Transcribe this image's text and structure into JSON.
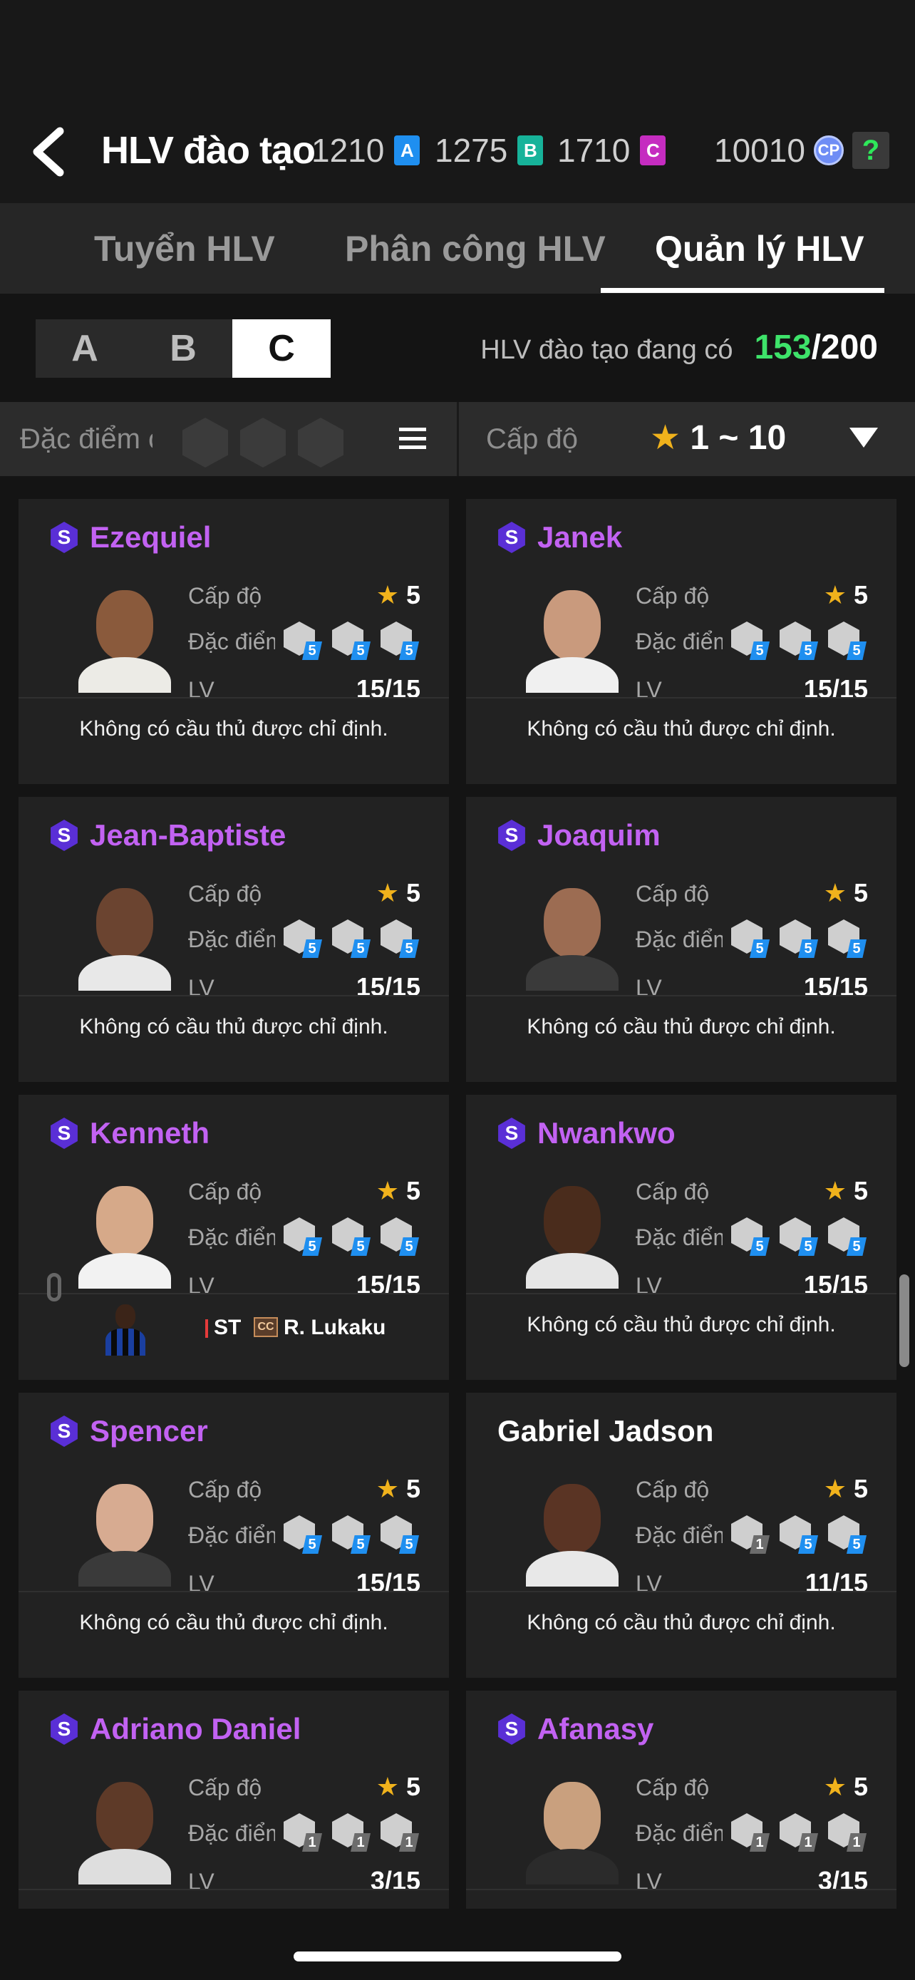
{
  "header": {
    "title": "HLV đào tạo",
    "currencies": [
      {
        "amount": "1210",
        "badge": "A",
        "color": "#1f8ff0"
      },
      {
        "amount": "1275",
        "badge": "B",
        "color": "#17b39a"
      },
      {
        "amount": "1710",
        "badge": "C",
        "color": "#c52cc0"
      }
    ],
    "cp_amount": "10010",
    "cp_badge": "CP",
    "help": "?"
  },
  "tabs": [
    "Tuyển HLV",
    "Phân công HLV",
    "Quản lý HLV"
  ],
  "active_tab": 2,
  "segments": [
    "A",
    "B",
    "C"
  ],
  "active_segment": 2,
  "count": {
    "label": "HLV đào tạo đang có",
    "current": "153",
    "max": "/200"
  },
  "filter": {
    "traits_label": "Đặc điểm c",
    "level_label": "Cấp độ",
    "level_range": "1 ~ 10"
  },
  "labels": {
    "level": "Cấp độ",
    "traits": "Đặc điểm",
    "traits_cut": "Đặc điểm",
    "lv": "LV",
    "none": "Không có cầu thủ được chỉ định."
  },
  "coaches": [
    {
      "name": "Ezequiel",
      "special": true,
      "badge": "S",
      "level": "5",
      "lv": "15/15",
      "traits": [
        "5",
        "5",
        "5"
      ],
      "assigned": false,
      "skin": "#8a5a3c",
      "shirt": "#ecebe6"
    },
    {
      "name": "Janek",
      "special": true,
      "badge": "S",
      "level": "5",
      "lv": "15/15",
      "traits": [
        "5",
        "5",
        "5"
      ],
      "assigned": false,
      "skin": "#c99a7d",
      "shirt": "#f0f0f0"
    },
    {
      "name": "Jean-Baptiste",
      "special": true,
      "badge": "S",
      "level": "5",
      "lv": "15/15",
      "traits": [
        "5",
        "5",
        "5"
      ],
      "assigned": false,
      "skin": "#6b4430",
      "shirt": "#e8e8e8"
    },
    {
      "name": "Joaquim",
      "special": true,
      "badge": "S",
      "level": "5",
      "lv": "15/15",
      "traits": [
        "5",
        "5",
        "5"
      ],
      "assigned": false,
      "skin": "#9c6c52",
      "shirt": "#3a3a3a"
    },
    {
      "name": "Kenneth",
      "special": true,
      "badge": "S",
      "level": "5",
      "lv": "15/15",
      "traits": [
        "5",
        "5",
        "5"
      ],
      "assigned": true,
      "player_pos": "ST",
      "player_cc": "CC",
      "player_name": "R. Lukaku",
      "skin": "#d6a989",
      "shirt": "#f2f2f2"
    },
    {
      "name": "Nwankwo",
      "special": true,
      "badge": "S",
      "level": "5",
      "lv": "15/15",
      "traits": [
        "5",
        "5",
        "5"
      ],
      "assigned": false,
      "skin": "#4a2c1c",
      "shirt": "#e6e6e6"
    },
    {
      "name": "Spencer",
      "special": true,
      "badge": "S",
      "level": "5",
      "lv": "15/15",
      "traits": [
        "5",
        "5",
        "5"
      ],
      "assigned": false,
      "skin": "#d7ab91",
      "shirt": "#3a3a3a"
    },
    {
      "name": "Gabriel Jadson",
      "special": false,
      "badge": "",
      "level": "5",
      "lv": "11/15",
      "traits": [
        "1",
        "5",
        "5"
      ],
      "assigned": false,
      "skin": "#5a3424",
      "shirt": "#e8e8e8"
    },
    {
      "name": "Adriano Daniel",
      "special": true,
      "badge": "S",
      "level": "5",
      "lv": "3/15",
      "traits": [
        "1",
        "1",
        "1"
      ],
      "assigned": false,
      "skin": "#5e3a28",
      "shirt": "#dedede"
    },
    {
      "name": "Afanasy",
      "special": true,
      "badge": "S",
      "level": "5",
      "lv": "3/15",
      "traits": [
        "1",
        "1",
        "1"
      ],
      "assigned": false,
      "skin": "#c9a07e",
      "shirt": "#2b2b2b"
    }
  ],
  "icons": [
    "back-arrow-icon",
    "menu-icon",
    "star-icon",
    "dropdown-triangle-icon",
    "link-icon"
  ],
  "colors": {
    "accent_purple": "#c262f2",
    "count_green": "#3ee36a",
    "star": "#f0b21c",
    "trait_blue": "#1f8ff0"
  }
}
